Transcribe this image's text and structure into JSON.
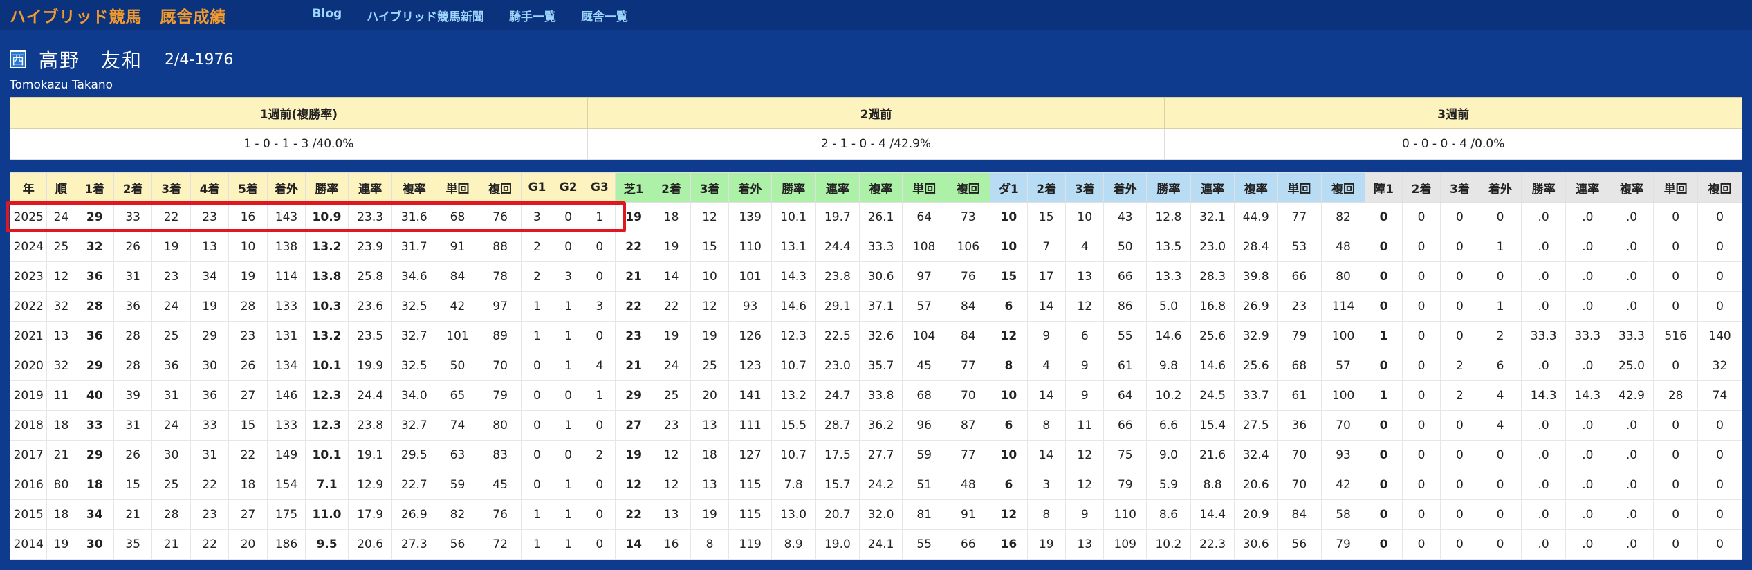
{
  "brand": {
    "part1": "ハイブリッド競馬",
    "part2": "厩舎成績"
  },
  "nav": [
    "Blog",
    "ハイブリッド競馬新聞",
    "騎手一覧",
    "厩舎一覧"
  ],
  "jockey": {
    "badge": "西",
    "name": "高野　友和",
    "dob": "2/4-1976",
    "roman": "Tomokazu Takano"
  },
  "summary": {
    "headers": [
      "1週前(複勝率)",
      "2週前",
      "3週前"
    ],
    "values": [
      "1 - 0 - 1 - 3 /40.0%",
      "2 - 1 - 0 - 4 /42.9%",
      "0 - 0 - 0 - 4 /0.0%"
    ]
  },
  "stats": {
    "headers": [
      "年",
      "順",
      "1着",
      "2着",
      "3着",
      "4着",
      "5着",
      "着外",
      "勝率",
      "連率",
      "複率",
      "単回",
      "複回",
      "G1",
      "G2",
      "G3",
      "芝1",
      "2着",
      "3着",
      "着外",
      "勝率",
      "連率",
      "複率",
      "単回",
      "複回",
      "ダ1",
      "2着",
      "3着",
      "着外",
      "勝率",
      "連率",
      "複率",
      "単回",
      "複回",
      "障1",
      "2着",
      "3着",
      "着外",
      "勝率",
      "連率",
      "複率",
      "単回",
      "複回"
    ],
    "rows": [
      [
        "2025",
        "24",
        "29",
        "33",
        "22",
        "23",
        "16",
        "143",
        "10.9",
        "23.3",
        "31.6",
        "68",
        "76",
        "3",
        "0",
        "1",
        "19",
        "18",
        "12",
        "139",
        "10.1",
        "19.7",
        "26.1",
        "64",
        "73",
        "10",
        "15",
        "10",
        "43",
        "12.8",
        "32.1",
        "44.9",
        "77",
        "82",
        "0",
        "0",
        "0",
        "0",
        ".0",
        ".0",
        ".0",
        "0",
        "0"
      ],
      [
        "2024",
        "25",
        "32",
        "26",
        "19",
        "13",
        "10",
        "138",
        "13.2",
        "23.9",
        "31.7",
        "91",
        "88",
        "2",
        "0",
        "0",
        "22",
        "19",
        "15",
        "110",
        "13.1",
        "24.4",
        "33.3",
        "108",
        "106",
        "10",
        "7",
        "4",
        "50",
        "13.5",
        "23.0",
        "28.4",
        "53",
        "48",
        "0",
        "0",
        "0",
        "1",
        ".0",
        ".0",
        ".0",
        "0",
        "0"
      ],
      [
        "2023",
        "12",
        "36",
        "31",
        "23",
        "34",
        "19",
        "114",
        "13.8",
        "25.8",
        "34.6",
        "84",
        "78",
        "2",
        "3",
        "0",
        "21",
        "14",
        "10",
        "101",
        "14.3",
        "23.8",
        "30.6",
        "97",
        "76",
        "15",
        "17",
        "13",
        "66",
        "13.3",
        "28.3",
        "39.8",
        "66",
        "80",
        "0",
        "0",
        "0",
        "0",
        ".0",
        ".0",
        ".0",
        "0",
        "0"
      ],
      [
        "2022",
        "32",
        "28",
        "36",
        "24",
        "19",
        "28",
        "133",
        "10.3",
        "23.6",
        "32.5",
        "42",
        "97",
        "1",
        "1",
        "3",
        "22",
        "22",
        "12",
        "93",
        "14.6",
        "29.1",
        "37.1",
        "57",
        "84",
        "6",
        "14",
        "12",
        "86",
        "5.0",
        "16.8",
        "26.9",
        "23",
        "114",
        "0",
        "0",
        "0",
        "1",
        ".0",
        ".0",
        ".0",
        "0",
        "0"
      ],
      [
        "2021",
        "13",
        "36",
        "28",
        "25",
        "29",
        "23",
        "131",
        "13.2",
        "23.5",
        "32.7",
        "101",
        "89",
        "1",
        "1",
        "0",
        "23",
        "19",
        "19",
        "126",
        "12.3",
        "22.5",
        "32.6",
        "104",
        "84",
        "12",
        "9",
        "6",
        "55",
        "14.6",
        "25.6",
        "32.9",
        "79",
        "100",
        "1",
        "0",
        "0",
        "2",
        "33.3",
        "33.3",
        "33.3",
        "516",
        "140"
      ],
      [
        "2020",
        "32",
        "29",
        "28",
        "36",
        "30",
        "26",
        "134",
        "10.1",
        "19.9",
        "32.5",
        "50",
        "70",
        "0",
        "1",
        "4",
        "21",
        "24",
        "25",
        "123",
        "10.7",
        "23.0",
        "35.7",
        "45",
        "77",
        "8",
        "4",
        "9",
        "61",
        "9.8",
        "14.6",
        "25.6",
        "68",
        "57",
        "0",
        "0",
        "2",
        "6",
        ".0",
        ".0",
        "25.0",
        "0",
        "32"
      ],
      [
        "2019",
        "11",
        "40",
        "39",
        "31",
        "36",
        "27",
        "146",
        "12.3",
        "24.4",
        "34.0",
        "65",
        "79",
        "0",
        "0",
        "1",
        "29",
        "25",
        "20",
        "141",
        "13.2",
        "24.7",
        "33.8",
        "68",
        "70",
        "10",
        "14",
        "9",
        "64",
        "10.2",
        "24.5",
        "33.7",
        "61",
        "100",
        "1",
        "0",
        "2",
        "4",
        "14.3",
        "14.3",
        "42.9",
        "28",
        "74"
      ],
      [
        "2018",
        "18",
        "33",
        "31",
        "24",
        "33",
        "15",
        "133",
        "12.3",
        "23.8",
        "32.7",
        "74",
        "80",
        "0",
        "1",
        "0",
        "27",
        "23",
        "13",
        "111",
        "15.5",
        "28.7",
        "36.2",
        "96",
        "87",
        "6",
        "8",
        "11",
        "66",
        "6.6",
        "15.4",
        "27.5",
        "36",
        "70",
        "0",
        "0",
        "0",
        "4",
        ".0",
        ".0",
        ".0",
        "0",
        "0"
      ],
      [
        "2017",
        "21",
        "29",
        "26",
        "30",
        "31",
        "22",
        "149",
        "10.1",
        "19.1",
        "29.5",
        "63",
        "83",
        "0",
        "0",
        "2",
        "19",
        "12",
        "18",
        "127",
        "10.7",
        "17.5",
        "27.7",
        "59",
        "77",
        "10",
        "14",
        "12",
        "75",
        "9.0",
        "21.6",
        "32.4",
        "70",
        "93",
        "0",
        "0",
        "0",
        "0",
        ".0",
        ".0",
        ".0",
        "0",
        "0"
      ],
      [
        "2016",
        "80",
        "18",
        "15",
        "25",
        "22",
        "18",
        "154",
        "7.1",
        "12.9",
        "22.7",
        "59",
        "45",
        "0",
        "1",
        "0",
        "12",
        "12",
        "13",
        "115",
        "7.8",
        "15.7",
        "24.2",
        "51",
        "48",
        "6",
        "3",
        "12",
        "79",
        "5.9",
        "8.8",
        "20.6",
        "70",
        "42",
        "0",
        "0",
        "0",
        "0",
        ".0",
        ".0",
        ".0",
        "0",
        "0"
      ],
      [
        "2015",
        "18",
        "34",
        "21",
        "28",
        "23",
        "27",
        "175",
        "11.0",
        "17.9",
        "26.9",
        "82",
        "76",
        "1",
        "1",
        "0",
        "22",
        "13",
        "19",
        "115",
        "13.0",
        "20.7",
        "32.0",
        "81",
        "91",
        "12",
        "8",
        "9",
        "110",
        "8.6",
        "14.4",
        "20.9",
        "84",
        "58",
        "0",
        "0",
        "0",
        "0",
        ".0",
        ".0",
        ".0",
        "0",
        "0"
      ],
      [
        "2014",
        "19",
        "30",
        "35",
        "21",
        "22",
        "20",
        "186",
        "9.5",
        "20.6",
        "27.3",
        "56",
        "72",
        "1",
        "1",
        "0",
        "14",
        "16",
        "8",
        "119",
        "8.9",
        "19.0",
        "24.1",
        "55",
        "66",
        "16",
        "19",
        "13",
        "109",
        "10.2",
        "22.3",
        "30.6",
        "56",
        "79",
        "0",
        "0",
        "0",
        "0",
        ".0",
        ".0",
        ".0",
        "0",
        "0"
      ]
    ]
  }
}
